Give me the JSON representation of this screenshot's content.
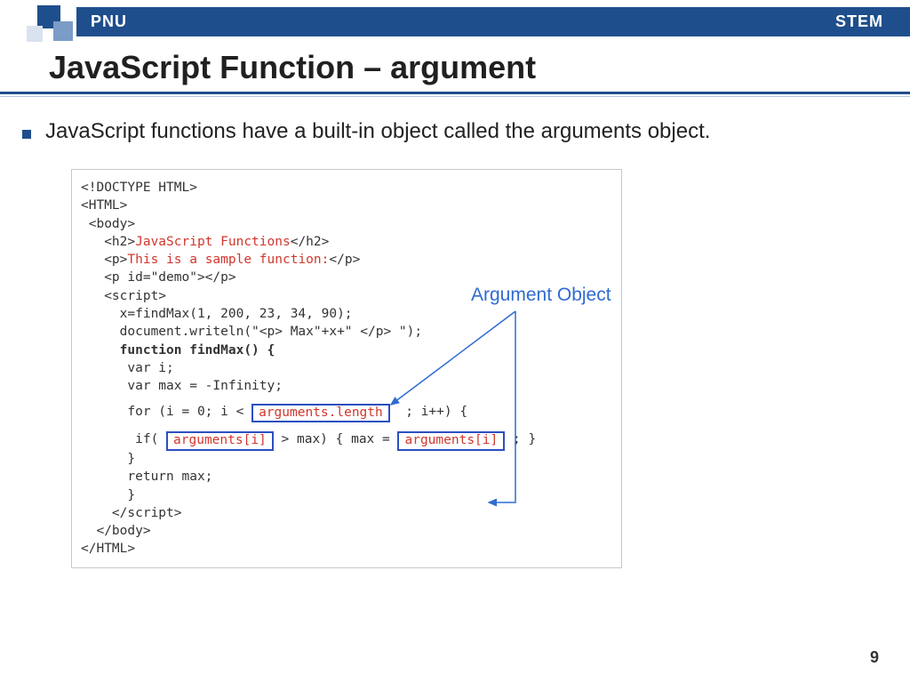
{
  "header": {
    "left": "PNU",
    "right": "STEM"
  },
  "title": "JavaScript Function – argument",
  "bullet": "JavaScript functions have a built-in object called the arguments object.",
  "callout_label": "Argument Object",
  "code": {
    "l1": "<!DOCTYPE HTML>",
    "l2": "<HTML>",
    "l3": " <body>",
    "l4_a": "   <h2>",
    "l4_b": "JavaScript Functions",
    "l4_c": "</h2>",
    "l5_a": "   <p>",
    "l5_b": "This is a sample function:",
    "l5_c": "</p>",
    "l6": "   <p id=\"demo\"></p>",
    "l7": "   <script>",
    "l8": "     x=findMax(1, 200, 23, 34, 90);",
    "l9": "     document.writeln(\"<p> Max\"+x+\" </p> \");",
    "l10": "     function findMax() {",
    "l11": "      var i;",
    "l12": "      var max = -Infinity;",
    "l13a": "      for (i = 0; i < ",
    "l13_hl": "arguments.length",
    "l13b": "  ; i++) {",
    "l14a": "       if( ",
    "l14_hl1": "arguments[i]",
    "l14b": " > max) { max = ",
    "l14_hl2": "arguments[i]",
    "l14c": " ; }",
    "l15": "      }",
    "l16": "      return max;",
    "l17": "      }",
    "l18": "    </script>",
    "l19": "  </body>",
    "l20": "</HTML>"
  },
  "page_number": "9"
}
